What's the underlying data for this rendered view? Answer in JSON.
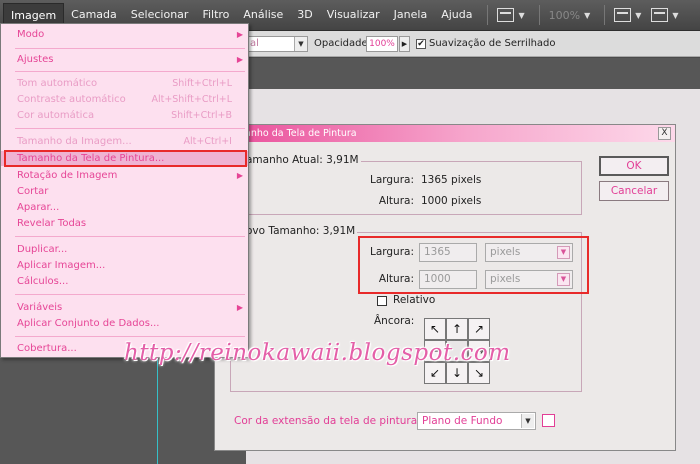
{
  "menubar": {
    "items": [
      "Imagem",
      "Camada",
      "Selecionar",
      "Filtro",
      "Análise",
      "3D",
      "Visualizar",
      "Janela",
      "Ajuda"
    ],
    "zoom": "100%"
  },
  "options_bar": {
    "mode_value": "al",
    "opacity_label": "Opacidade:",
    "opacity_value": "100%",
    "antialias_label": "Suavização de Serrilhado",
    "antialias_checked": "✔"
  },
  "image_menu": {
    "items": [
      {
        "label": "Modo",
        "shortcut": "",
        "submenu": "▶"
      },
      {
        "label": "Ajustes",
        "shortcut": "",
        "submenu": "▶"
      },
      {
        "label": "Tom automático",
        "shortcut": "Shift+Ctrl+L",
        "submenu": ""
      },
      {
        "label": "Contraste automático",
        "shortcut": "Alt+Shift+Ctrl+L",
        "submenu": ""
      },
      {
        "label": "Cor automática",
        "shortcut": "Shift+Ctrl+B",
        "submenu": ""
      },
      {
        "label": "Tamanho da Imagem...",
        "shortcut": "Alt+Ctrl+I",
        "submenu": ""
      },
      {
        "label": "Tamanho da Tela de Pintura...",
        "shortcut": "",
        "submenu": ""
      },
      {
        "label": "Rotação de Imagem",
        "shortcut": "",
        "submenu": "▶"
      },
      {
        "label": "Cortar",
        "shortcut": "",
        "submenu": ""
      },
      {
        "label": "Aparar...",
        "shortcut": "",
        "submenu": ""
      },
      {
        "label": "Revelar Todas",
        "shortcut": "",
        "submenu": ""
      },
      {
        "label": "Duplicar...",
        "shortcut": "",
        "submenu": ""
      },
      {
        "label": "Aplicar Imagem...",
        "shortcut": "",
        "submenu": ""
      },
      {
        "label": "Cálculos...",
        "shortcut": "",
        "submenu": ""
      },
      {
        "label": "Variáveis",
        "shortcut": "",
        "submenu": "▶"
      },
      {
        "label": "Aplicar Conjunto de Dados...",
        "shortcut": "",
        "submenu": ""
      },
      {
        "label": "Cobertura...",
        "shortcut": "",
        "submenu": ""
      }
    ]
  },
  "dialog": {
    "title": "anho da Tela de Pintura",
    "close": "X",
    "current_size_label": "amanho Atual: 3,91M",
    "current_width_label": "Largura:",
    "current_width_value": "1365 pixels",
    "current_height_label": "Altura:",
    "current_height_value": "1000 pixels",
    "new_size_label": "ovo Tamanho: 3,91M",
    "width_label": "Largura:",
    "width_value": "1365",
    "width_unit": "pixels",
    "height_label": "Altura:",
    "height_value": "1000",
    "height_unit": "pixels",
    "relative_label": "Relativo",
    "anchor_label": "Âncora:",
    "anchor_arrows": [
      "↖",
      "↑",
      "↗",
      "←",
      "",
      "→",
      "↙",
      "↓",
      "↘"
    ],
    "extension_color_label": "Cor da extensão da tela de pintura:",
    "extension_color_value": "Plano de Fundo",
    "ok_label": "OK",
    "cancel_label": "Cancelar"
  },
  "watermark": "http://reinokawaii.blogspot.com"
}
